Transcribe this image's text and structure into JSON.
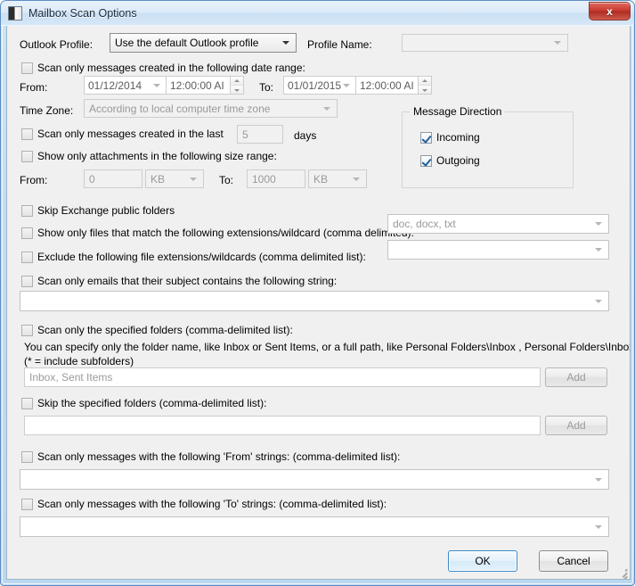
{
  "window": {
    "title": "Mailbox Scan Options",
    "close_label": "x",
    "icon": "mailbox-icon"
  },
  "profile": {
    "outlook_profile_label": "Outlook Profile:",
    "outlook_profile_value": "Use the default Outlook profile",
    "profile_name_label": "Profile Name:",
    "profile_name_value": ""
  },
  "date_range": {
    "checkbox_label": "Scan only messages created in the following date range:",
    "checked": false,
    "from_label": "From:",
    "from_date": "01/12/2014",
    "from_time": "12:00:00 AI",
    "to_label": "To:",
    "to_date": "01/01/2015",
    "to_time": "12:00:00 AI",
    "time_zone_label": "Time Zone:",
    "time_zone_value": "According to local computer time zone"
  },
  "last_days": {
    "checkbox_label": "Scan only messages created in the last",
    "checked": false,
    "value": "5",
    "unit_label": "days"
  },
  "size_range": {
    "checkbox_label": "Show only attachments in the following size range:",
    "checked": false,
    "from_label": "From:",
    "from_value": "0",
    "from_unit": "KB",
    "to_label": "To:",
    "to_value": "1000",
    "to_unit": "KB"
  },
  "message_direction": {
    "group_title": "Message Direction",
    "incoming_label": "Incoming",
    "incoming_checked": true,
    "outgoing_label": "Outgoing",
    "outgoing_checked": true
  },
  "options": {
    "skip_public_folders_label": "Skip Exchange public folders",
    "skip_public_folders_checked": false,
    "include_extensions_label": "Show only files that match the following extensions/wildcard (comma delimited):",
    "include_extensions_checked": false,
    "include_extensions_value": "doc, docx, txt",
    "exclude_extensions_label": "Exclude the following file extensions/wildcards (comma delimited list):",
    "exclude_extensions_checked": false,
    "exclude_extensions_value": "",
    "subject_contains_label": "Scan only emails that their subject contains the following string:",
    "subject_contains_checked": false,
    "subject_contains_value": ""
  },
  "scan_folders": {
    "checkbox_label": "Scan only the specified folders (comma-delimited list):",
    "checked": false,
    "hint_line1": "You can specify only the folder name, like Inbox or Sent Items, or a full path, like Personal Folders\\Inbox , Personal Folders\\Inbox*",
    "hint_line2": " (* = include subfolders)",
    "input_placeholder": "Inbox, Sent Items",
    "add_label": "Add"
  },
  "skip_folders": {
    "checkbox_label": "Skip the specified folders (comma-delimited list):",
    "checked": false,
    "input_value": "",
    "add_label": "Add"
  },
  "from_strings": {
    "checkbox_label": "Scan only messages with the following 'From' strings: (comma-delimited list):",
    "checked": false,
    "value": ""
  },
  "to_strings": {
    "checkbox_label": "Scan only messages with the following 'To' strings: (comma-delimited list):",
    "checked": false,
    "value": ""
  },
  "footer": {
    "ok_label": "OK",
    "cancel_label": "Cancel"
  }
}
